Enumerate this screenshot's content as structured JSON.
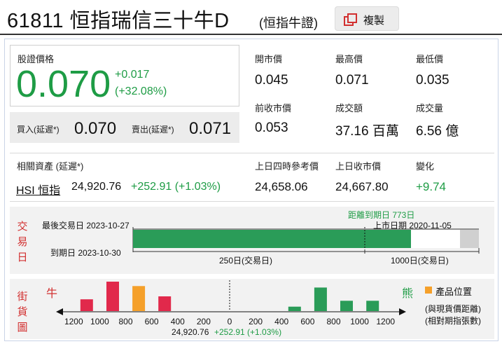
{
  "header": {
    "code": "61811",
    "name": "恒指瑞信三十牛D",
    "subtitle": "(恒指牛證)",
    "copy_label": "複製"
  },
  "quote": {
    "price_label": "股證價格",
    "price": "0.070",
    "change": "+0.017",
    "change_pct": "(+32.08%)",
    "bid_label": "買入(延遲*)",
    "bid": "0.070",
    "ask_label": "賣出(延遲*)",
    "ask": "0.071"
  },
  "stats": [
    {
      "label": "開市價",
      "value": "0.045"
    },
    {
      "label": "最高價",
      "value": "0.071"
    },
    {
      "label": "最低價",
      "value": "0.035"
    },
    {
      "label": "前收市價",
      "value": "0.053"
    },
    {
      "label": "成交額",
      "value": "37.16 百萬"
    },
    {
      "label": "成交量",
      "value": "6.56 億"
    }
  ],
  "underlying": {
    "label": "相關資產 (延遲*)",
    "link": "HSI 恒指",
    "price": "24,920.76",
    "change": "+252.91 (+1.03%)",
    "items": [
      {
        "label": "上日四時參考價",
        "value": "24,658.06"
      },
      {
        "label": "上日收市價",
        "value": "24,667.80"
      },
      {
        "label": "變化",
        "value": "+9.74"
      }
    ]
  },
  "trading": {
    "side_label": [
      "交",
      "易",
      "日"
    ],
    "last_trade": "最後交易日 2023-10-27",
    "expiry": "到期日 2023-10-30",
    "days_to_expiry": "距離到期日 773日",
    "listing": "上市日期 2020-11-05",
    "tick_250": "250日(交易日)",
    "tick_1000": "1000日(交易日)",
    "progress_fraction": 0.85,
    "colors": {
      "progress": "#2a9c58",
      "remaining": "#ffffff",
      "end": "#d0d0d0"
    }
  },
  "street": {
    "side_label": [
      "街",
      "貨",
      "圖"
    ],
    "bull_label": "牛",
    "bear_label": "熊",
    "legend_label": "產品位置",
    "note1": "(與現貨價距離)",
    "note2": "(相對期指張數)",
    "underlying_text": "24,920.76",
    "underlying_change": "+252.91 (+1.03%)",
    "ticks": [
      "1200",
      "1000",
      "800",
      "600",
      "400",
      "200",
      "0",
      "200",
      "400",
      "600",
      "800",
      "1000",
      "1200"
    ],
    "bull_bars": [
      {
        "distance": 1100,
        "height": 0.4
      },
      {
        "distance": 900,
        "height": 1.0
      },
      {
        "distance": 700,
        "height": 0.85,
        "highlight": true
      },
      {
        "distance": 500,
        "height": 0.5
      }
    ],
    "bear_bars": [
      {
        "distance": 500,
        "height": 0.15
      },
      {
        "distance": 700,
        "height": 0.8
      },
      {
        "distance": 900,
        "height": 0.35
      },
      {
        "distance": 1100,
        "height": 0.35
      }
    ],
    "colors": {
      "bull": "#e1294b",
      "bear": "#2a9c58",
      "highlight": "#f5a02a"
    }
  }
}
